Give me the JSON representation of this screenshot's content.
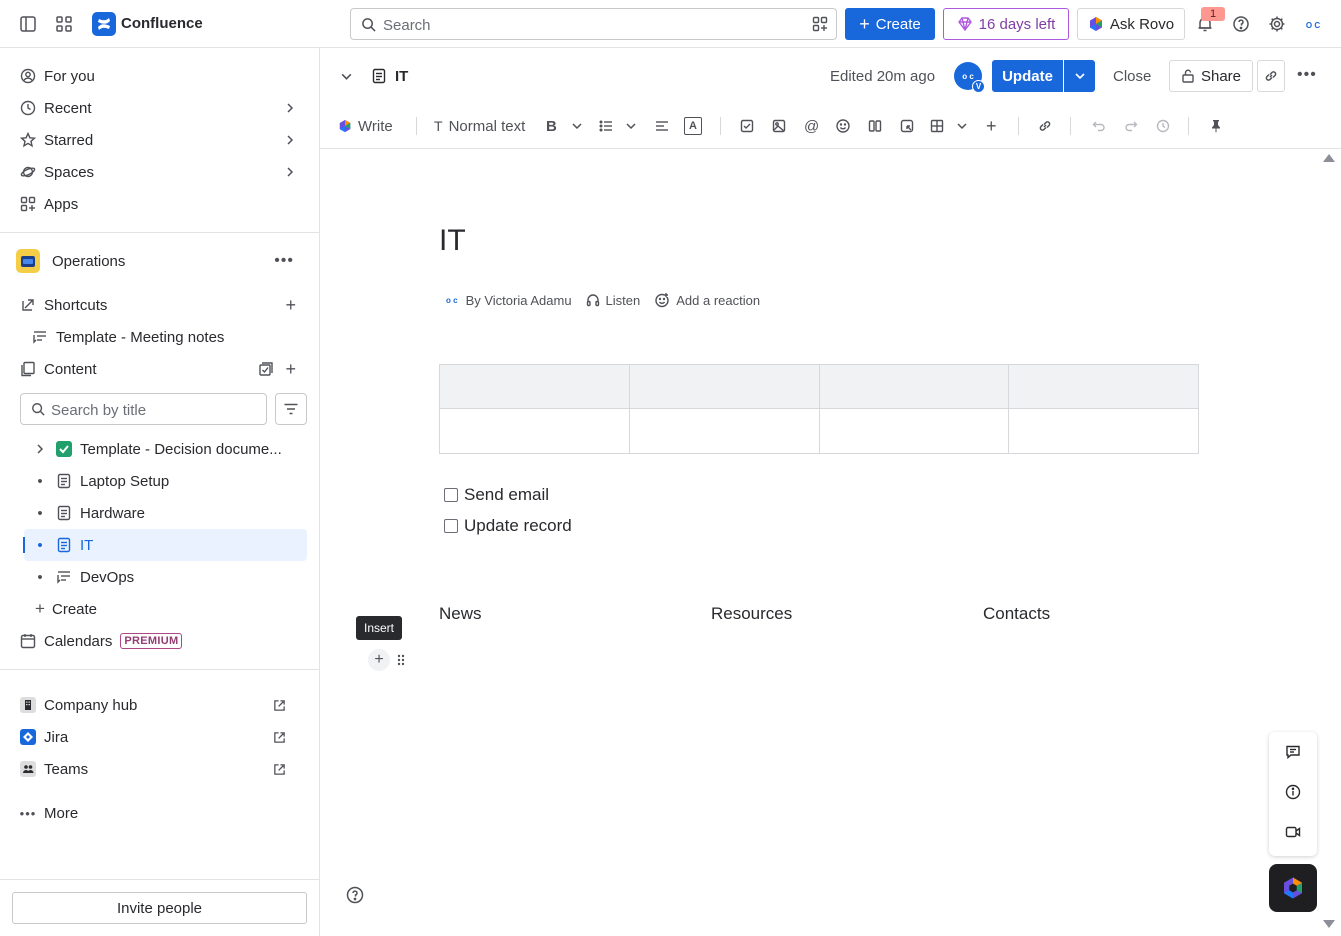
{
  "topbar": {
    "brand": "Confluence",
    "search_placeholder": "Search",
    "create_label": "Create",
    "trial_label": "16 days left",
    "rovo_label": "Ask Rovo",
    "notification_count": "1",
    "avatar_initials": "O C"
  },
  "sidebar": {
    "nav": [
      {
        "label": "For you"
      },
      {
        "label": "Recent"
      },
      {
        "label": "Starred"
      },
      {
        "label": "Spaces"
      },
      {
        "label": "Apps"
      }
    ],
    "space_name": "Operations",
    "shortcuts_label": "Shortcuts",
    "shortcut_item": "Template - Meeting notes",
    "content_label": "Content",
    "title_search_placeholder": "Search by title",
    "tree": [
      {
        "label": "Template - Decision docume..."
      },
      {
        "label": "Laptop Setup"
      },
      {
        "label": "Hardware"
      },
      {
        "label": "IT"
      },
      {
        "label": "DevOps"
      }
    ],
    "create_label": "Create",
    "calendars_label": "Calendars",
    "premium_badge": "PREMIUM",
    "apps": [
      {
        "label": "Company hub"
      },
      {
        "label": "Jira"
      },
      {
        "label": "Teams"
      }
    ],
    "more_label": "More",
    "invite_label": "Invite people"
  },
  "page": {
    "breadcrumb_title": "IT",
    "edited": "Edited 20m ago",
    "avatar_badge": "V",
    "update_label": "Update",
    "close_label": "Close",
    "share_label": "Share",
    "title": "IT",
    "author": "By Victoria Adamu",
    "listen": "Listen",
    "reaction": "Add a reaction",
    "tasks": [
      {
        "label": "Send email",
        "checked": false
      },
      {
        "label": "Update record",
        "checked": false
      }
    ],
    "columns": [
      "News",
      "Resources",
      "Contacts"
    ],
    "tooltip": "Insert"
  },
  "toolbar": {
    "write_label": "Write",
    "text_style": "Normal text"
  },
  "colors": {
    "accent": "#1868db",
    "trial_border": "#af59e1",
    "selected_bg": "#e9f2fe"
  }
}
